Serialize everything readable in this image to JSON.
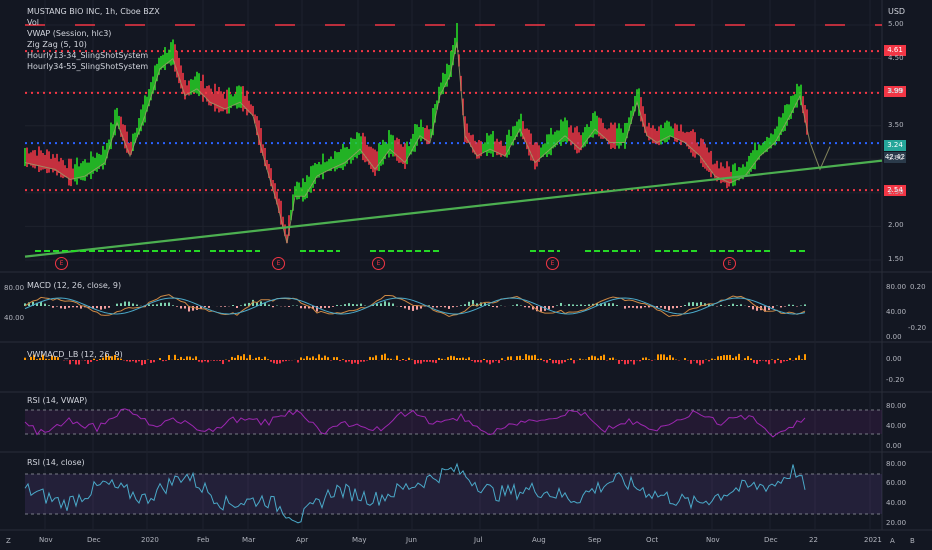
{
  "header": {
    "symbol": "MUSTANG BIO INC, 1h, Cboe BZX",
    "currency": "USD"
  },
  "indicators_main": [
    "Vol",
    "VWAP (Session, hlc3)",
    "Zig Zag (5, 10)",
    "Hourly13-34_SlingShotSystem",
    "Hourly34-55_SlingShotSystem"
  ],
  "price_boxes": [
    {
      "text": "4.61",
      "color": "#f23645"
    },
    {
      "text": "3.99",
      "color": "#f23645"
    },
    {
      "text": "3.24",
      "color": "#26a69a"
    },
    {
      "text": "42:42",
      "color": "#2a3a4a"
    },
    {
      "text": "2.54",
      "color": "#f23645"
    }
  ],
  "earnings_label": "E",
  "panes": {
    "macd": {
      "title": "MACD (12, 26, close, 9)",
      "left_ticks": [
        "80.00",
        "40.00"
      ],
      "right_ticks": [
        "80.00",
        "40.00",
        "0.00"
      ],
      "far_right_ticks": [
        "0.20",
        "-0.20"
      ]
    },
    "vwmacd": {
      "title": "VWMACD_LB (12, 26, 9)",
      "right_ticks": [
        "0.00",
        "-0.20"
      ]
    },
    "rsi_vwap": {
      "title": "RSI (14, VWAP)",
      "right_ticks": [
        "80.00",
        "40.00",
        "0.00"
      ]
    },
    "rsi_close": {
      "title": "RSI (14, close)",
      "right_ticks": [
        "80.00",
        "60.00",
        "40.00",
        "20.00"
      ]
    }
  },
  "controls": {
    "left_badge": "Z",
    "right_a": "A",
    "right_b": "B"
  },
  "colors": {
    "up": "#26d926",
    "down": "#f23645",
    "trend": "#4caf50",
    "rsi_line": "#4aa8c8",
    "rsi_vwap_line": "#9c27b0",
    "macd_line": "#f57c00",
    "signal": "#26a69a"
  },
  "chart_data": [
    {
      "type": "line",
      "title": "MUSTANG BIO INC, 1h, Cboe BZX",
      "xlabel": "",
      "ylabel": "USD",
      "x_ticks": [
        "Nov",
        "Dec",
        "2020",
        "Feb",
        "Mar",
        "Apr",
        "May",
        "Jun",
        "Jul",
        "Aug",
        "Sep",
        "Oct",
        "Nov",
        "Dec",
        "22",
        "2021"
      ],
      "y_ticks": [
        5.0,
        4.5,
        4.0,
        3.5,
        3.0,
        2.5,
        2.0,
        1.5
      ],
      "ylim": [
        1.45,
        5.1
      ],
      "series": [
        {
          "x": [
            0,
            30,
            45,
            60,
            80,
            92,
            105,
            120,
            135,
            148,
            160,
            172,
            185,
            200,
            215,
            228,
            240,
            252,
            262,
            270,
            280,
            292,
            305,
            320,
            335,
            350,
            365,
            380,
            395,
            405,
            415,
            425,
            432,
            440,
            452,
            465,
            480,
            495,
            510,
            525,
            540,
            555,
            570,
            585,
            600,
            612,
            622,
            632,
            645,
            660,
            675,
            690,
            705,
            720,
            735,
            750,
            765,
            775,
            785,
            795,
            805
          ],
          "y": [
            3.0,
            2.9,
            2.75,
            2.8,
            3.0,
            3.6,
            3.1,
            3.7,
            4.4,
            4.55,
            4.0,
            4.1,
            3.9,
            3.8,
            3.9,
            3.7,
            3.0,
            2.4,
            1.8,
            2.5,
            2.5,
            2.8,
            2.9,
            3.0,
            3.2,
            2.9,
            3.2,
            3.0,
            3.4,
            3.3,
            4.0,
            4.3,
            4.8,
            3.4,
            3.1,
            3.2,
            3.1,
            3.5,
            3.0,
            3.2,
            3.4,
            3.2,
            3.5,
            3.3,
            3.3,
            3.9,
            3.4,
            3.3,
            3.4,
            3.3,
            3.1,
            2.8,
            2.7,
            2.8,
            3.1,
            3.3,
            3.7,
            3.99,
            3.3,
            2.9,
            3.24
          ]
        }
      ],
      "horizontal_levels": [
        4.61,
        3.99,
        3.24,
        2.54,
        5.0
      ],
      "trendline": {
        "x": [
          25,
          882
        ],
        "y": [
          1.55,
          2.98
        ]
      }
    },
    {
      "type": "line",
      "title": "RSI (14, close)",
      "xlabel": "",
      "ylabel": "",
      "ylim": [
        20,
        80
      ],
      "levels": [
        70,
        30
      ],
      "series": [
        {
          "x": [
            0,
            40,
            80,
            120,
            160,
            200,
            240,
            275,
            310,
            350,
            390,
            430,
            470,
            510,
            550,
            590,
            630,
            670,
            710,
            750,
            770,
            790,
            805
          ],
          "y": [
            55,
            40,
            60,
            45,
            70,
            40,
            45,
            25,
            55,
            45,
            60,
            75,
            50,
            55,
            45,
            65,
            50,
            40,
            55,
            60,
            75,
            35,
            65
          ]
        }
      ]
    }
  ]
}
